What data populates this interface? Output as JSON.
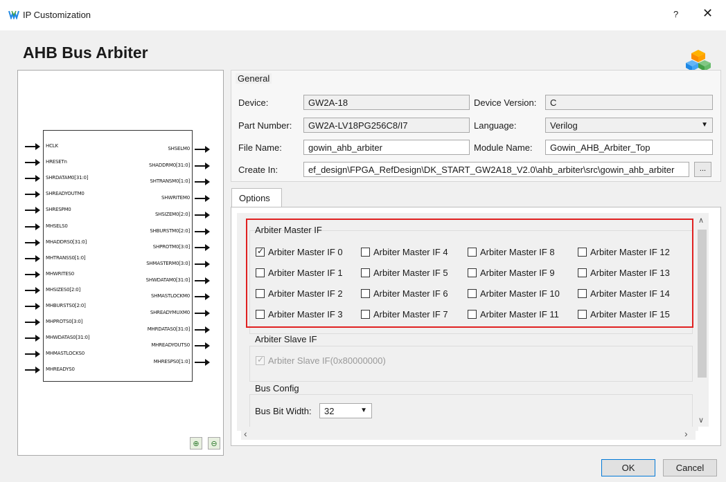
{
  "window": {
    "title": "IP Customization",
    "help": "?",
    "close": "✕"
  },
  "ip": {
    "title": "AHB Bus Arbiter"
  },
  "diagram": {
    "inputs": [
      "HCLK",
      "HRESETn",
      "SHRDATAM0[31:0]",
      "SHREADYOUTM0",
      "SHRESPM0",
      "MHSELS0",
      "MHADDRS0[31:0]",
      "MHTRANSS0[1:0]",
      "MHWRITES0",
      "MHSIZES0[2:0]",
      "MHBURSTS0[2:0]",
      "MHPROTS0[3:0]",
      "MHWDATAS0[31:0]",
      "MHMASTLOCKS0",
      "MHREADYS0"
    ],
    "outputs": [
      "SHSELM0",
      "SHADDRM0[31:0]",
      "SHTRANSM0[1:0]",
      "SHWRITEM0",
      "SHSIZEM0[2:0]",
      "SHBURSTM0[2:0]",
      "SHPROTM0[3:0]",
      "SHMASTERM0[3:0]",
      "SHWDATAM0[31:0]",
      "SHMASTLOCKM0",
      "SHREADYMUXM0",
      "MHRDATAS0[31:0]",
      "MHREADYOUTS0",
      "MHRESPS0[1:0]"
    ]
  },
  "general": {
    "label": "General",
    "device_label": "Device:",
    "device": "GW2A-18",
    "device_version_label": "Device Version:",
    "device_version": "C",
    "part_number_label": "Part Number:",
    "part_number": "GW2A-LV18PG256C8/I7",
    "language_label": "Language:",
    "language": "Verilog",
    "file_name_label": "File Name:",
    "file_name": "gowin_ahb_arbiter",
    "module_name_label": "Module Name:",
    "module_name": "Gowin_AHB_Arbiter_Top",
    "create_in_label": "Create In:",
    "create_in": "ef_design\\FPGA_RefDesign\\DK_START_GW2A18_V2.0\\ahb_arbiter\\src\\gowin_ahb_arbiter",
    "browse": "..."
  },
  "tabs": {
    "options": "Options"
  },
  "master_if": {
    "title": "Arbiter Master IF",
    "items": [
      {
        "label": "Arbiter Master IF 0",
        "checked": true
      },
      {
        "label": "Arbiter Master IF 1",
        "checked": false
      },
      {
        "label": "Arbiter Master IF 2",
        "checked": false
      },
      {
        "label": "Arbiter Master IF 3",
        "checked": false
      },
      {
        "label": "Arbiter Master IF 4",
        "checked": false
      },
      {
        "label": "Arbiter Master IF 5",
        "checked": false
      },
      {
        "label": "Arbiter Master IF 6",
        "checked": false
      },
      {
        "label": "Arbiter Master IF 7",
        "checked": false
      },
      {
        "label": "Arbiter Master IF 8",
        "checked": false
      },
      {
        "label": "Arbiter Master IF 9",
        "checked": false
      },
      {
        "label": "Arbiter Master IF 10",
        "checked": false
      },
      {
        "label": "Arbiter Master IF 11",
        "checked": false
      },
      {
        "label": "Arbiter Master IF 12",
        "checked": false
      },
      {
        "label": "Arbiter Master IF 13",
        "checked": false
      },
      {
        "label": "Arbiter Master IF 14",
        "checked": false
      },
      {
        "label": "Arbiter Master IF 15",
        "checked": false
      }
    ]
  },
  "slave_if": {
    "title": "Arbiter Slave IF",
    "item": "Arbiter Slave IF(0x80000000)"
  },
  "bus_config": {
    "title": "Bus Config",
    "width_label": "Bus Bit Width:",
    "width": "32"
  },
  "buttons": {
    "ok": "OK",
    "cancel": "Cancel"
  }
}
